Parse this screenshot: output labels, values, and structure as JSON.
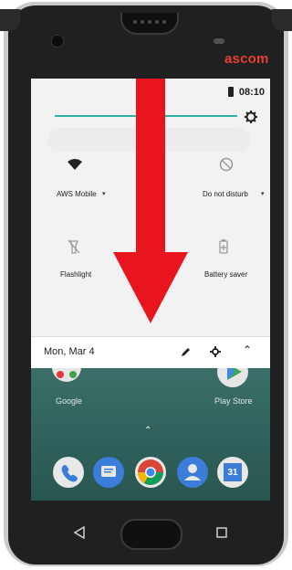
{
  "device": {
    "brand": "ascom"
  },
  "status_bar": {
    "time": "08:10"
  },
  "quick_settings": {
    "tiles": [
      {
        "label": "AWS Mobile"
      },
      {
        "label": "Do not disturb"
      },
      {
        "label": "Flashlight"
      },
      {
        "label": "Battery saver"
      }
    ]
  },
  "footer": {
    "date": "Mon, Mar 4"
  },
  "home_apps": [
    {
      "label": "Google"
    },
    {
      "label": "Play Store"
    }
  ],
  "dock_calendar_day": "31",
  "colors": {
    "brand": "#e8402f",
    "arrow": "#e8141e",
    "accent": "#2bb3a3"
  },
  "icons": [
    "gear-icon",
    "wifi-icon",
    "dnd-icon",
    "flashlight-icon",
    "battery-saver-icon",
    "pencil-icon",
    "chevron-up-icon",
    "back-icon",
    "recents-icon"
  ]
}
